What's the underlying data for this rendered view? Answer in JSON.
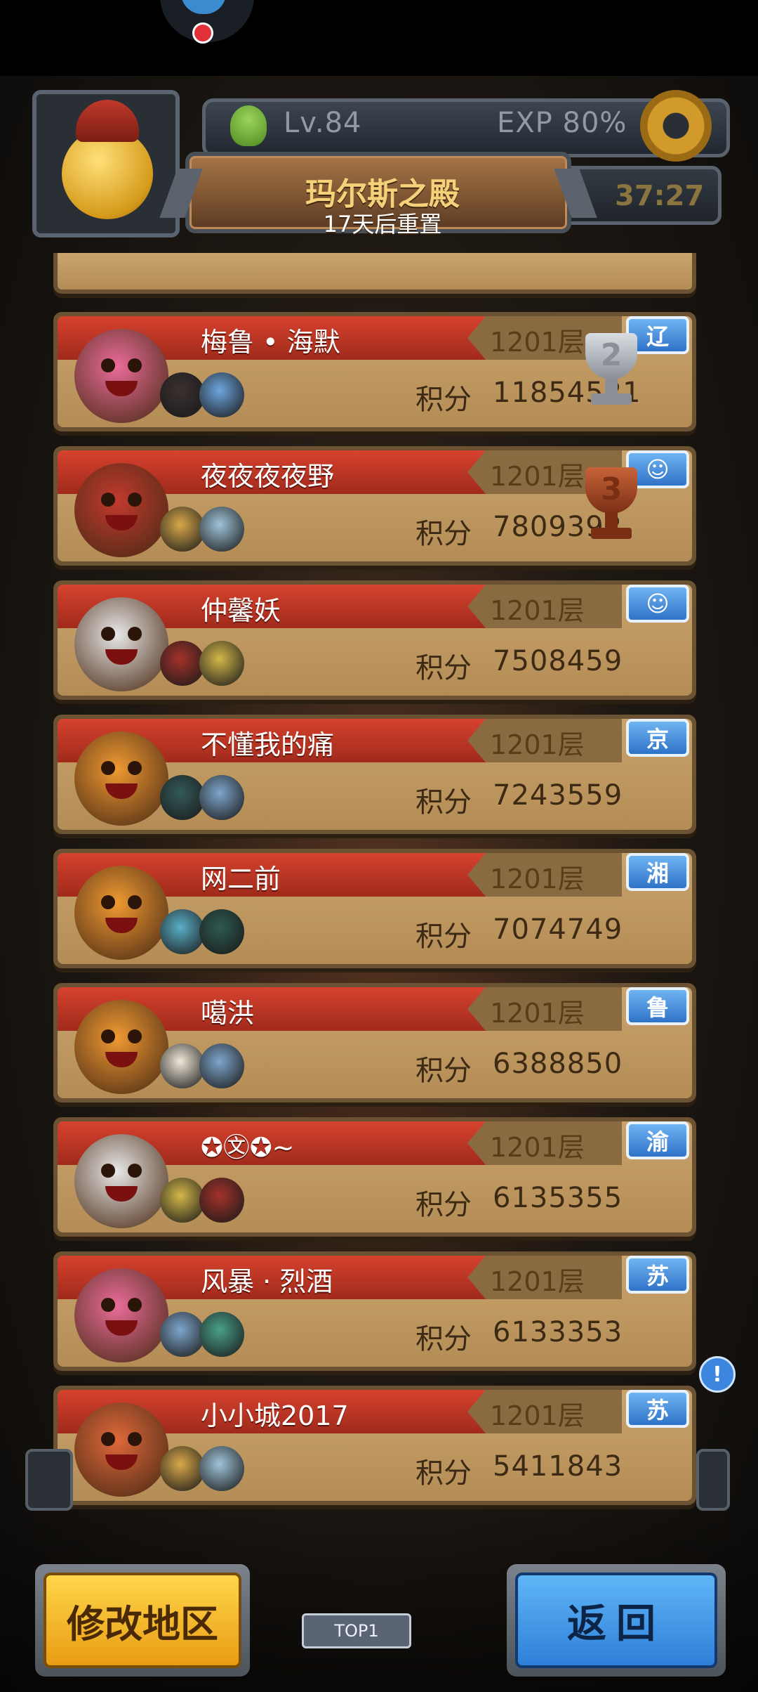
{
  "header": {
    "level": "Lv.84",
    "exp": "EXP 80%",
    "timer": "37:27",
    "palace_title": "玛尔斯之殿",
    "reset_text": "17天后重置"
  },
  "score_label": "积分",
  "ranks": [
    {
      "name": "梅鲁 • 海默",
      "layer": "1201层",
      "region": "辽",
      "score": "11854521",
      "trophy": "2",
      "main_color": "#ea6c9a",
      "s1": "#3b3030",
      "s2": "#6ea6e0"
    },
    {
      "name": "夜夜夜夜野",
      "layer": "1201层",
      "region": "☺",
      "score": "7809392",
      "trophy": "3",
      "main_color": "#c23a2e",
      "s1": "#d8a84a",
      "s2": "#9fc4d8"
    },
    {
      "name": "仲馨妖",
      "layer": "1201层",
      "region": "☺",
      "score": "7508459",
      "trophy": "",
      "main_color": "#e8e8e8",
      "s1": "#a3322a",
      "s2": "#d4b84a"
    },
    {
      "name": "不懂我的痛",
      "layer": "1201层",
      "region": "京",
      "score": "7243559",
      "trophy": "",
      "main_color": "#f09a32",
      "s1": "#335a5a",
      "s2": "#7ea6cc"
    },
    {
      "name": "网二前",
      "layer": "1201层",
      "region": "湘",
      "score": "7074749",
      "trophy": "",
      "main_color": "#f09a32",
      "s1": "#5ab0c8",
      "s2": "#2e5a52"
    },
    {
      "name": "噶洪",
      "layer": "1201层",
      "region": "鲁",
      "score": "6388850",
      "trophy": "",
      "main_color": "#f09a32",
      "s1": "#f0e8d8",
      "s2": "#7ea6cc"
    },
    {
      "name": "✪㉆✪~",
      "layer": "1201层",
      "region": "渝",
      "score": "6135355",
      "trophy": "",
      "main_color": "#e8e8e8",
      "s1": "#d4b84a",
      "s2": "#a3322a"
    },
    {
      "name": "风暴 · 烈酒",
      "layer": "1201层",
      "region": "苏",
      "score": "6133353",
      "trophy": "",
      "main_color": "#ea6c9a",
      "s1": "#7ea6cc",
      "s2": "#4aa08a"
    },
    {
      "name": "小小城2017",
      "layer": "1201层",
      "region": "苏",
      "score": "5411843",
      "trophy": "",
      "main_color": "#e0683a",
      "s1": "#d8a84a",
      "s2": "#9fc4d8"
    }
  ],
  "buttons": {
    "modify_region": "修改地区",
    "back": "返回"
  },
  "scene": {
    "top1_sign": "TOP1",
    "info": "!"
  }
}
